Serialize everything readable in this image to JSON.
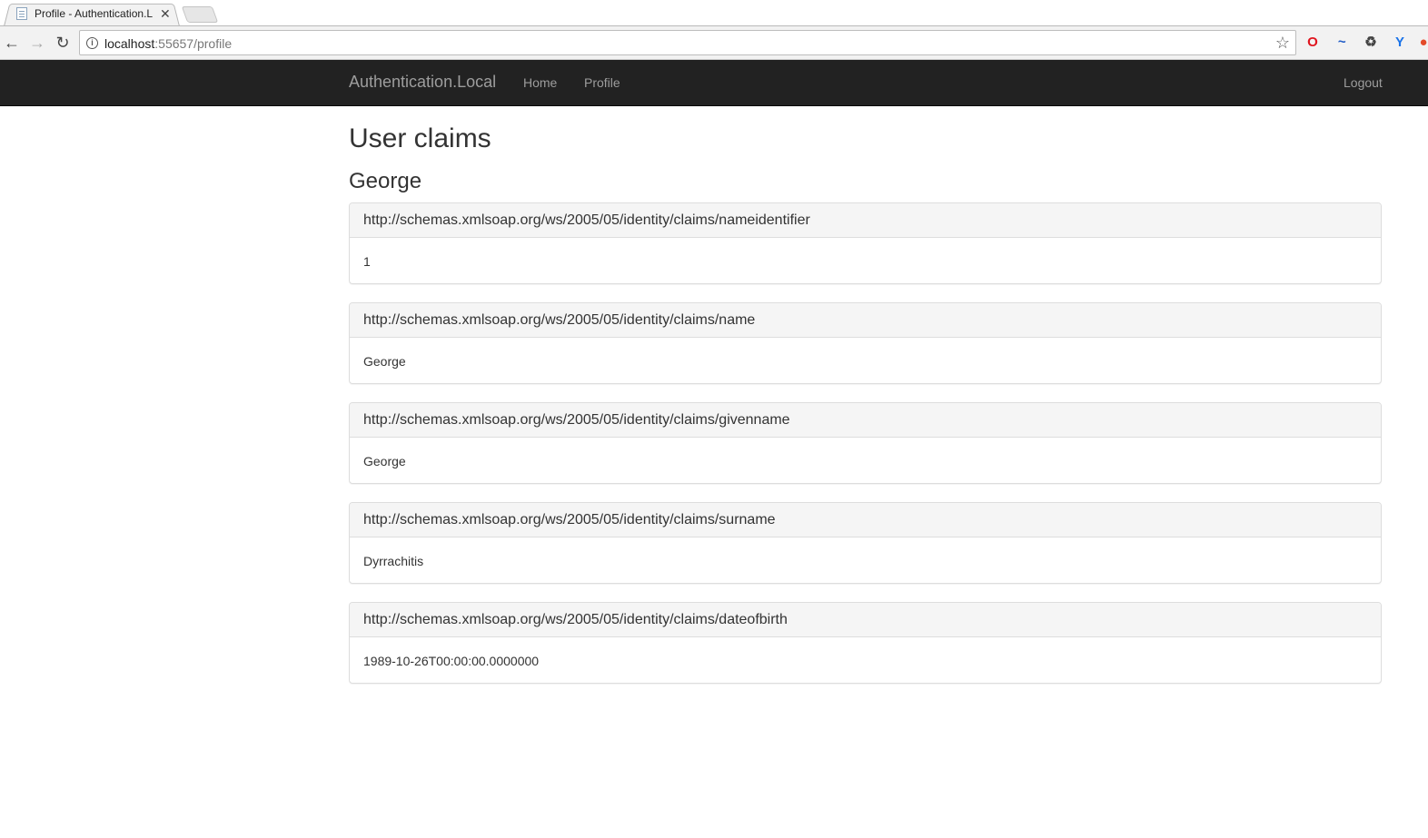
{
  "browser": {
    "tab_title": "Profile - Authentication.L",
    "tab_close": "✕",
    "url_host": "localhost",
    "url_rest": ":55657/profile",
    "icons": [
      "back-arrow-icon",
      "forward-arrow-icon",
      "reload-icon",
      "info-icon",
      "star-icon",
      "opera-icon",
      "wave-icon",
      "recycle-icon",
      "y-icon"
    ]
  },
  "navbar": {
    "brand": "Authentication.Local",
    "links": [
      "Home",
      "Profile"
    ],
    "logout": "Logout",
    "bg_color": "#222222",
    "link_color": "#9d9d9d"
  },
  "main": {
    "title": "User claims",
    "user_name": "George",
    "claims": [
      {
        "type": "http://schemas.xmlsoap.org/ws/2005/05/identity/claims/nameidentifier",
        "value": "1"
      },
      {
        "type": "http://schemas.xmlsoap.org/ws/2005/05/identity/claims/name",
        "value": "George"
      },
      {
        "type": "http://schemas.xmlsoap.org/ws/2005/05/identity/claims/givenname",
        "value": "George"
      },
      {
        "type": "http://schemas.xmlsoap.org/ws/2005/05/identity/claims/surname",
        "value": "Dyrrachitis"
      },
      {
        "type": "http://schemas.xmlsoap.org/ws/2005/05/identity/claims/dateofbirth",
        "value": "1989-10-26T00:00:00.0000000"
      }
    ]
  }
}
